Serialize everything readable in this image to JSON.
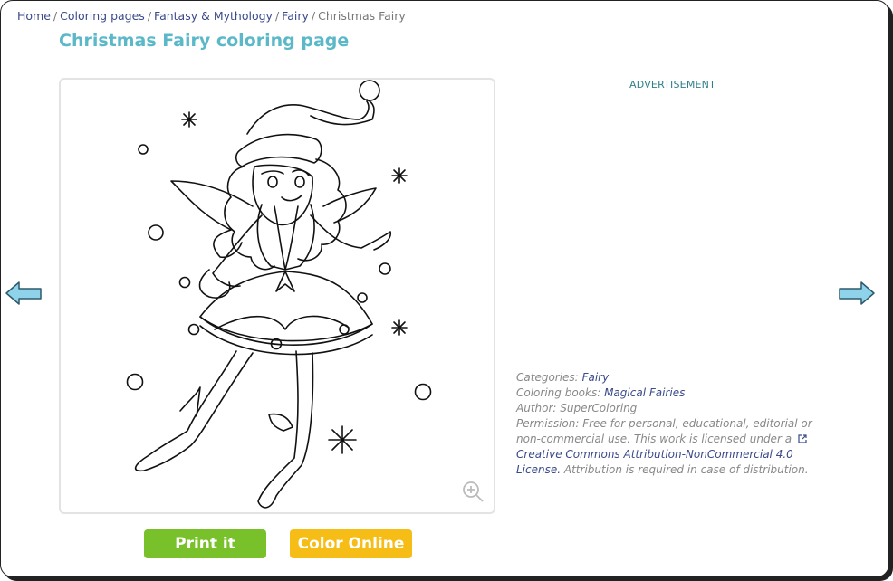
{
  "breadcrumb": {
    "items": [
      {
        "label": "Home"
      },
      {
        "label": "Coloring pages"
      },
      {
        "label": "Fantasy & Mythology"
      },
      {
        "label": "Fairy"
      }
    ],
    "current": "Christmas Fairy",
    "separator": "/"
  },
  "page": {
    "title": "Christmas Fairy coloring page"
  },
  "actions": {
    "print_label": "Print it",
    "color_label": "Color Online",
    "print_color": "#78c12a",
    "color_color": "#f6bd16"
  },
  "sidebar": {
    "ad_label": "ADVERTISEMENT"
  },
  "meta": {
    "categories_label": "Categories:",
    "categories_value": "Fairy",
    "books_label": "Coloring books:",
    "books_value": "Magical Fairies",
    "author_text": "Author: SuperColoring",
    "permission_text": "Permission:  Free for personal, educational, editorial or non-commercial use. This work is licensed under a",
    "license_link": "Creative Commons Attribution-NonCommercial 4.0 License.",
    "attribution_text": "Attribution is required in case of distribution."
  },
  "icons": {
    "prev": "left-arrow-icon",
    "next": "right-arrow-icon",
    "zoom": "zoom-in-icon",
    "external": "external-link-icon"
  },
  "colors": {
    "title": "#5bb8c8",
    "link": "#3a4a8a",
    "arrow": "#8fd3ea"
  }
}
